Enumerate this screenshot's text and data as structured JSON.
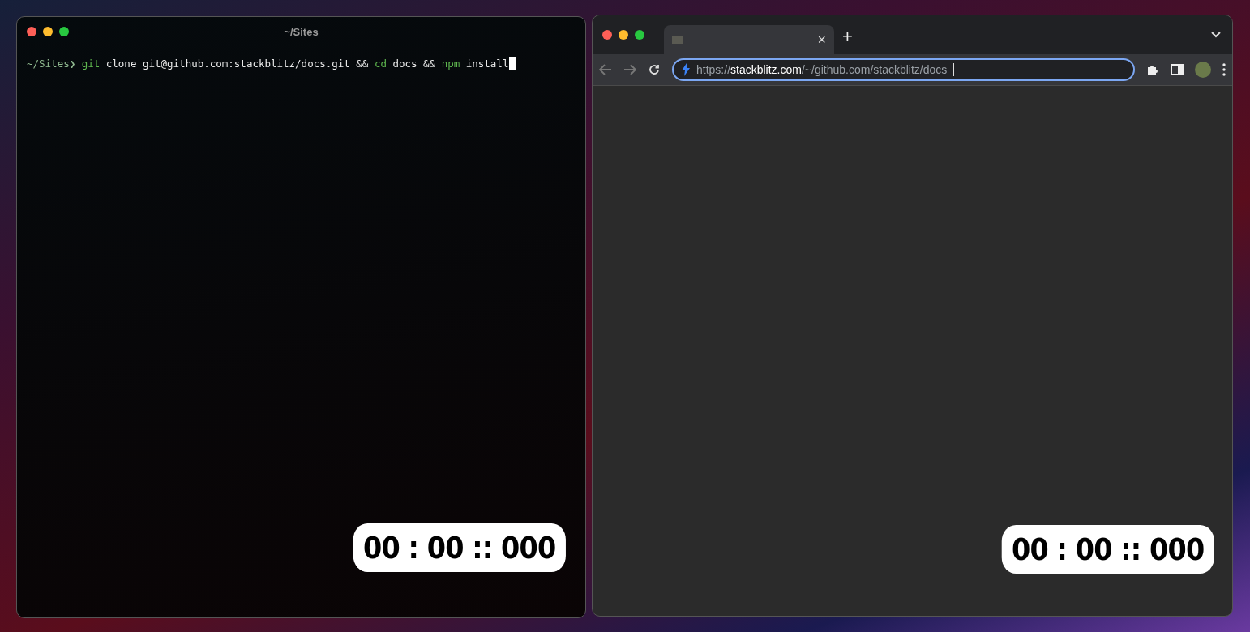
{
  "terminal": {
    "title": "~/Sites",
    "command": [
      {
        "kind": "prompt",
        "text": "~/Sites❯"
      },
      {
        "kind": "keyword",
        "text": "git"
      },
      {
        "kind": "plain",
        "text": "clone git@github.com:stackblitz/docs.git &&"
      },
      {
        "kind": "keyword",
        "text": "cd"
      },
      {
        "kind": "plain",
        "text": "docs &&"
      },
      {
        "kind": "keyword",
        "text": "npm"
      },
      {
        "kind": "plain",
        "text": "install"
      }
    ],
    "timer": "00 : 00 :: 000"
  },
  "browser": {
    "tab": {
      "close": "×"
    },
    "new_tab": "+",
    "url": [
      {
        "kind": "dim",
        "text": "https://"
      },
      {
        "kind": "host",
        "text": "stackblitz.com"
      },
      {
        "kind": "dim",
        "text": "/~/github.com/stackblitz/docs"
      }
    ],
    "timer": "00 : 00 :: 000"
  }
}
